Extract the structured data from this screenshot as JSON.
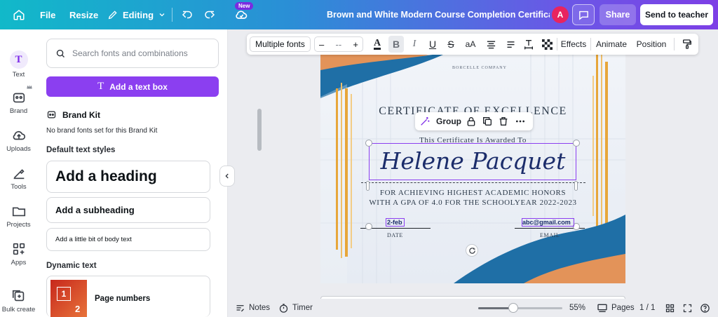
{
  "topbar": {
    "file": "File",
    "resize": "Resize",
    "editing": "Editing",
    "new_badge": "New",
    "doc_title": "Brown and White Modern Course Completion Certificate",
    "avatar_initial": "A",
    "share": "Share",
    "send": "Send to teacher",
    "icons": [
      "home-icon",
      "pencil-icon",
      "chevron-down-icon",
      "undo-icon",
      "redo-icon",
      "cloud-sync-icon",
      "comment-icon"
    ]
  },
  "rail": {
    "items": [
      {
        "label": "Text",
        "icon": "text-icon"
      },
      {
        "label": "Brand",
        "icon": "brand-icon"
      },
      {
        "label": "Uploads",
        "icon": "upload-icon"
      },
      {
        "label": "Tools",
        "icon": "tools-icon"
      },
      {
        "label": "Projects",
        "icon": "folder-icon"
      },
      {
        "label": "Apps",
        "icon": "apps-icon"
      },
      {
        "label": "Bulk create",
        "icon": "bulk-create-icon"
      }
    ]
  },
  "panel": {
    "search_placeholder": "Search fonts and combinations",
    "add_text_box": "Add a text box",
    "brand_kit": "Brand Kit",
    "brand_kit_sub": "No brand fonts set for this Brand Kit",
    "default_styles": "Default text styles",
    "heading": "Add a heading",
    "subheading": "Add a subheading",
    "body": "Add a little bit of body text",
    "dynamic_text": "Dynamic text",
    "page_numbers": "Page numbers",
    "thumb_numbers": [
      "1",
      "2"
    ]
  },
  "toolbar": {
    "font": "Multiple fonts",
    "minus": "–",
    "size": "--",
    "plus": "+",
    "case": "aA",
    "effects": "Effects",
    "animate": "Animate",
    "position": "Position"
  },
  "certificate": {
    "company": "BORCELLE COMPANY",
    "title": "CERTIFICATE OF EXCELLENCE",
    "awarded": "This Certificate Is Awarded To",
    "name": "Helene Pacquet",
    "line1": "FOR ACHIEVING HIGHEST ACADEMIC HONORS",
    "line2": "WITH A GPA OF 4.0 FOR THE SCHOOLYEAR 2022-2023",
    "date_value": "2-feb",
    "email_value": "abc@gmail.com",
    "date_label": "DATE",
    "email_label": "EMAIL",
    "colors": {
      "blue": "#1f6fa6",
      "orange": "#e0955a",
      "gold": "#e7a63a",
      "navy": "#1c2d6b"
    }
  },
  "group_bar": {
    "label": "Group"
  },
  "bottombar": {
    "notes": "Notes",
    "timer": "Timer",
    "zoom": "55%",
    "zoom_fraction": 0.42,
    "pages": "Pages",
    "page_count": "1 / 1"
  }
}
